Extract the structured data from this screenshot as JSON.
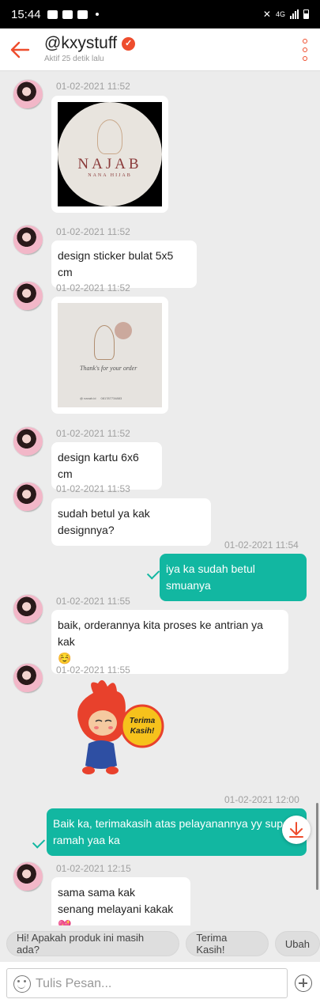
{
  "status_bar": {
    "time": "15:44",
    "network": "4G"
  },
  "header": {
    "title": "@kxystuff",
    "subtitle": "Aktif 25 detik lalu",
    "accent_color": "#ee4d2d"
  },
  "messages": [
    {
      "time": "01-02-2021 11:52",
      "image_text_1": "NAJAB",
      "image_text_2": "NANA HIJAB"
    },
    {
      "time": "01-02-2021 11:52",
      "text": "design sticker bulat 5x5 cm"
    },
    {
      "time": "01-02-2021 11:52",
      "image_text_1": "Thank's for your order",
      "image_text_2": "@ nanah.id",
      "image_text_3": "081787734883"
    },
    {
      "time": "01-02-2021 11:52",
      "text": "design kartu 6x6 cm"
    },
    {
      "time": "01-02-2021 11:53",
      "text": "sudah betul ya kak designnya?"
    },
    {
      "time": "01-02-2021 11:54",
      "text": "iya ka sudah betul smuanya"
    },
    {
      "time": "01-02-2021 11:55",
      "text": "baik, orderannya kita proses ke antrian ya kak",
      "emoji": "☺️"
    },
    {
      "time": "01-02-2021 11:55",
      "sticker_line1": "Terima",
      "sticker_line2": "Kasih!"
    },
    {
      "time": "01-02-2021 12:00",
      "text": "Baik ka, terimakasih atas pelayanannya yy super ramah yaa ka"
    },
    {
      "time": "01-02-2021 12:15",
      "line1": "sama sama kak",
      "line2": "senang melayani kakak",
      "emoji": "💖"
    }
  ],
  "quick_replies": [
    "Hi! Apakah produk ini masih ada?",
    "Terima Kasih!",
    "Ubah"
  ],
  "input": {
    "placeholder": "Tulis Pesan..."
  },
  "colors": {
    "my_bubble": "#12b7a1",
    "their_bubble": "#ffffff",
    "background": "#ececec"
  }
}
